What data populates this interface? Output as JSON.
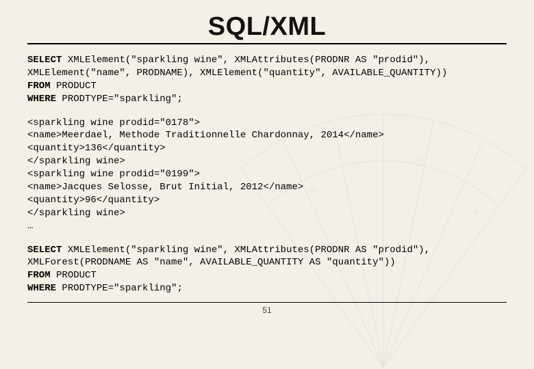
{
  "title": "SQL/XML",
  "page_number": "51",
  "code1": {
    "line1a": "SELECT",
    "line1b": "XMLElement(\"sparkling wine\", XMLAttributes(PRODNR AS \"prodid\"),",
    "line2": "XMLElement(\"name\", PRODNAME), XMLElement(\"quantity\", AVAILABLE_QUANTITY))",
    "line3a": "FROM",
    "line3b": "PRODUCT",
    "line4a": "WHERE",
    "line4b": "PRODTYPE=\"sparkling\";"
  },
  "output": {
    "l1": "<sparkling wine prodid=\"0178\">",
    "l2": "<name>Meerdael, Methode Traditionnelle Chardonnay, 2014</name>",
    "l3": "<quantity>136</quantity>",
    "l4": "</sparkling wine>",
    "l5": "<sparkling wine prodid=\"0199\">",
    "l6": "<name>Jacques Selosse, Brut Initial, 2012</name>",
    "l7": "<quantity>96</quantity>",
    "l8": "</sparkling wine>",
    "l9": "…"
  },
  "code2": {
    "line1a": "SELECT",
    "line1b": "XMLElement(\"sparkling wine\", XMLAttributes(PRODNR AS \"prodid\"),",
    "line2": "XMLForest(PRODNAME AS \"name\", AVAILABLE_QUANTITY AS \"quantity\"))",
    "line3a": "FROM",
    "line3b": "PRODUCT",
    "line4a": "WHERE",
    "line4b": "PRODTYPE=\"sparkling\";"
  }
}
